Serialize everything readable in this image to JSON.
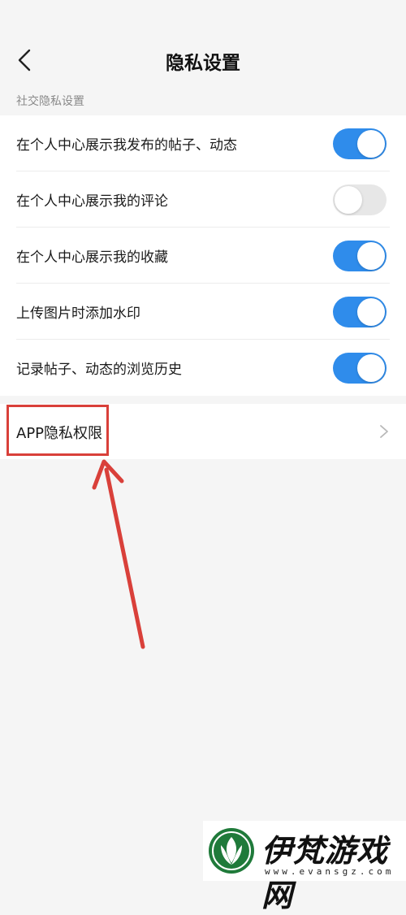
{
  "header": {
    "title": "隐私设置",
    "back_icon": "chevron-left-icon"
  },
  "section": {
    "label": "社交隐私设置"
  },
  "settings": [
    {
      "label": "在个人中心展示我发布的帖子、动态",
      "enabled": true
    },
    {
      "label": "在个人中心展示我的评论",
      "enabled": false
    },
    {
      "label": "在个人中心展示我的收藏",
      "enabled": true
    },
    {
      "label": "上传图片时添加水印",
      "enabled": true
    },
    {
      "label": "记录帖子、动态的浏览历史",
      "enabled": true
    }
  ],
  "app_permission": {
    "label": "APP隐私权限",
    "chevron_icon": "chevron-right-icon"
  },
  "annotation": {
    "highlight_color": "#d9403a"
  },
  "watermark": {
    "name": "伊梵游戏网",
    "url": "www.evansgz.com"
  },
  "colors": {
    "toggle_on": "#2f8ceb",
    "toggle_off": "#e7e7e7",
    "background": "#f5f5f5",
    "logo_green": "#1f7a3a"
  }
}
